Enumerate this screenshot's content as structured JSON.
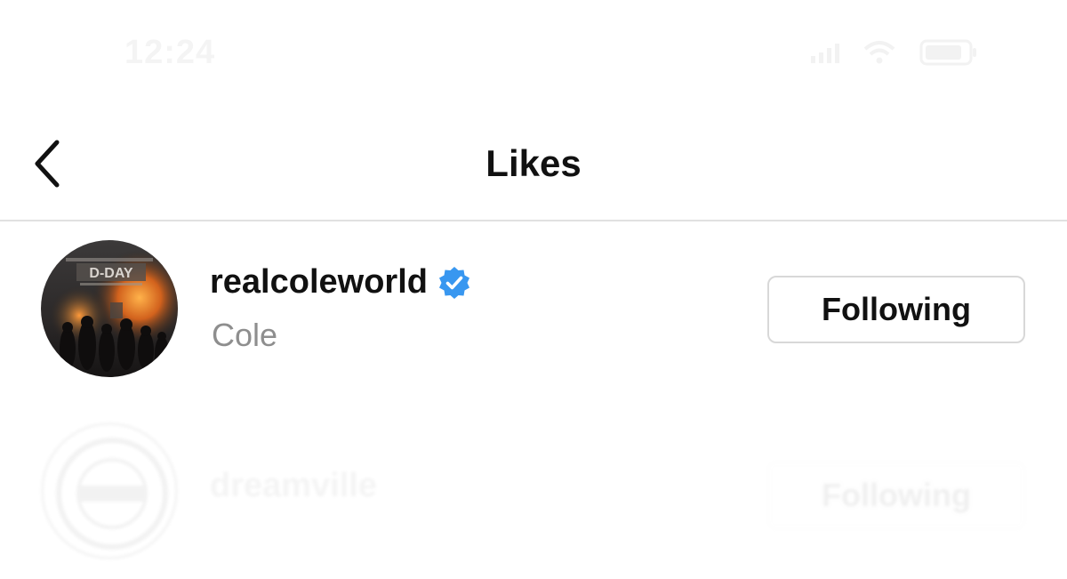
{
  "status_bar": {
    "time": "12:24"
  },
  "header": {
    "title": "Likes",
    "back_icon": "chevron-left-icon"
  },
  "likes": [
    {
      "username": "realcoleworld",
      "full_name": "Cole",
      "verified": true,
      "button_label": "Following",
      "avatar_text_top": "D-DAY"
    },
    {
      "username": "dreamville",
      "full_name": "",
      "verified": false,
      "button_label": "Following"
    }
  ],
  "colors": {
    "verified_badge": "#3897f0",
    "secondary_text": "#8e8e8e",
    "divider": "#e1e1e1",
    "button_border": "#d8d8d8"
  }
}
